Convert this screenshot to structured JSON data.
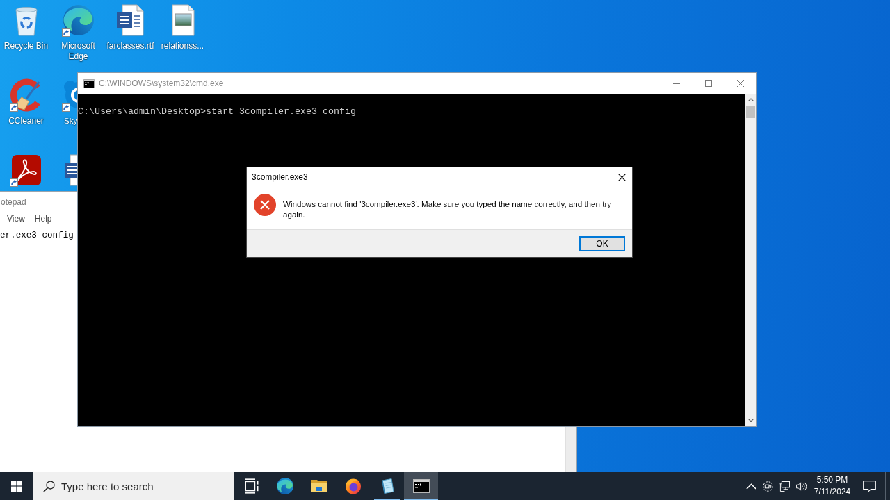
{
  "desktop_columns": [
    [
      {
        "kind": "recycle-bin",
        "label": "Recycle Bin",
        "shortcut": false
      },
      {
        "kind": "ccleaner",
        "label": "CCleaner",
        "shortcut": true
      },
      {
        "kind": "pdf-app",
        "shortcut": true
      }
    ],
    [
      {
        "kind": "edge",
        "label": "Microsoft Edge",
        "shortcut": true
      },
      {
        "kind": "skype",
        "label": "Sky",
        "shortcut": true
      },
      {
        "kind": "word-doc",
        "shortcut": false
      }
    ],
    [
      {
        "kind": "word-doc",
        "label": "farclasses.rtf",
        "shortcut": false
      }
    ],
    [
      {
        "kind": "image-file",
        "label": "relationss...",
        "shortcut": false
      }
    ]
  ],
  "notepad": {
    "title": "otepad",
    "menu": [
      "View",
      "Help"
    ],
    "text": "er.exe3 config"
  },
  "cmd": {
    "title": "C:\\WINDOWS\\system32\\cmd.exe",
    "lines": [
      "C:\\Users\\admin\\Desktop>start 3compiler.exe3 config"
    ]
  },
  "dialog": {
    "title": "3compiler.exe3",
    "message": "Windows cannot find '3compiler.exe3'. Make sure you typed the name correctly, and then try again.",
    "buttons": [
      {
        "label": "OK",
        "default": true
      }
    ]
  },
  "taskbar": {
    "search": {
      "placeholder": "Type here to search"
    },
    "apps": [
      {
        "kind": "task-view",
        "running": false,
        "active": false
      },
      {
        "kind": "edge",
        "running": false,
        "active": false
      },
      {
        "kind": "file-explorer",
        "running": false,
        "active": false
      },
      {
        "kind": "firefox",
        "running": false,
        "active": false
      },
      {
        "kind": "notepad",
        "running": true,
        "active": false
      },
      {
        "kind": "cmd",
        "running": true,
        "active": true
      }
    ],
    "tray": {
      "time": "5:50 PM",
      "date": "7/11/2024"
    }
  }
}
